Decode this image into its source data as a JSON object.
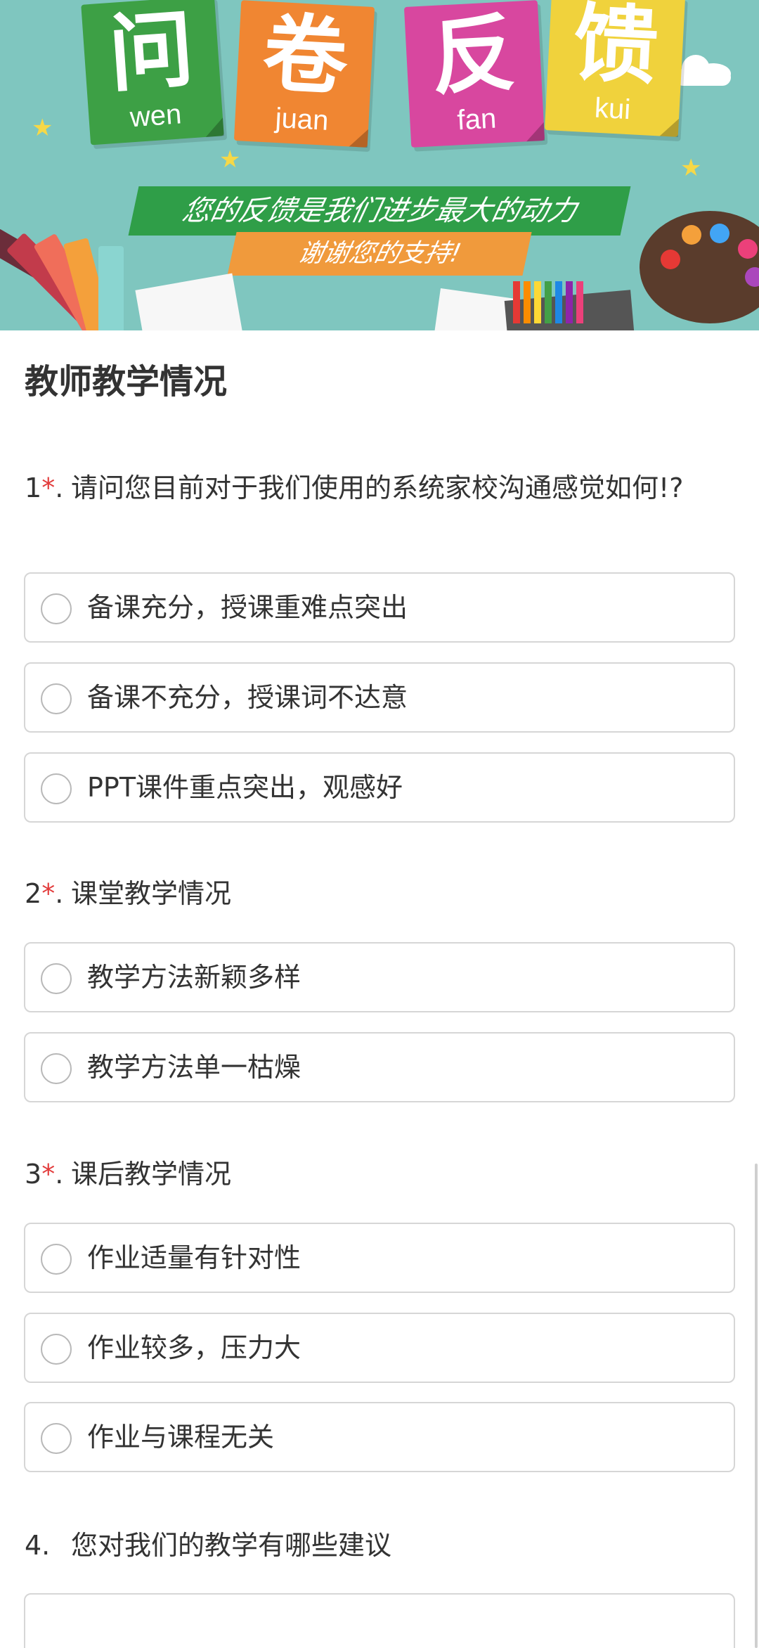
{
  "banner": {
    "tiles": [
      {
        "hanzi": "问",
        "pinyin": "wen"
      },
      {
        "hanzi": "卷",
        "pinyin": "juan"
      },
      {
        "hanzi": "反",
        "pinyin": "fan"
      },
      {
        "hanzi": "馈",
        "pinyin": "kui"
      }
    ],
    "slogan_1": "您的反馈是我们进步最大的动力",
    "slogan_2": "谢谢您的支持!"
  },
  "section_title": "教师教学情况",
  "questions": [
    {
      "number": "1",
      "required_mark": "*",
      "suffix": ".",
      "text": "请问您目前对于我们使用的系统家校沟通感觉如何!?",
      "options": [
        "备课充分，授课重难点突出",
        "备课不充分，授课词不达意",
        "PPT课件重点突出，观感好"
      ]
    },
    {
      "number": "2",
      "required_mark": "*",
      "suffix": ".",
      "text": "课堂教学情况",
      "options": [
        "教学方法新颖多样",
        "教学方法单一枯燥"
      ]
    },
    {
      "number": "3",
      "required_mark": "*",
      "suffix": ".",
      "text": "课后教学情况",
      "options": [
        "作业适量有针对性",
        "作业较多，压力大",
        "作业与课程无关"
      ]
    },
    {
      "number": "4.",
      "required_mark": "",
      "suffix": "",
      "text": "您对我们的教学有哪些建议",
      "options": []
    }
  ]
}
